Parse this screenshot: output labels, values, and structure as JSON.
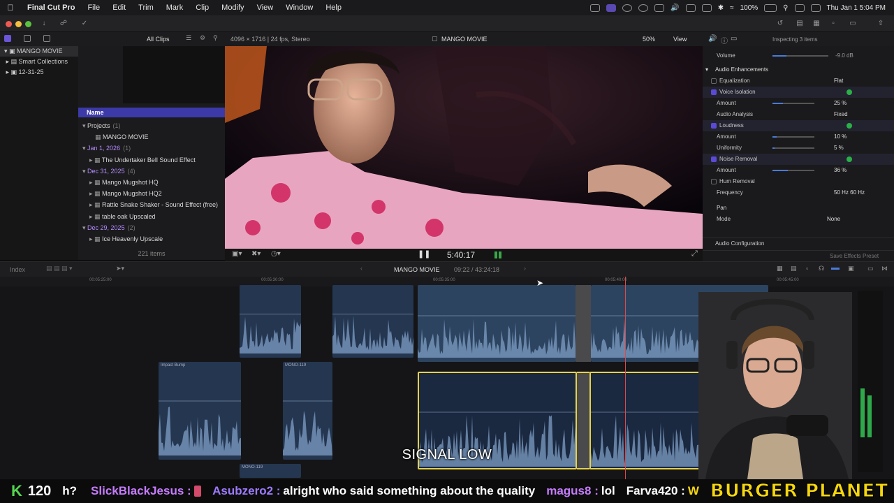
{
  "menubar": {
    "app_name": "Final Cut Pro",
    "items": [
      "File",
      "Edit",
      "Trim",
      "Mark",
      "Clip",
      "Modify",
      "View",
      "Window",
      "Help"
    ],
    "battery": "100%",
    "datetime": "Thu Jan 1 5:04 PM"
  },
  "library": {
    "items": [
      {
        "label": "MANGO MOVIE",
        "icon": "library-icon"
      },
      {
        "label": "Smart Collections",
        "icon": "folder-icon"
      },
      {
        "label": "12-31-25",
        "icon": "event-icon"
      }
    ]
  },
  "browser": {
    "filter_label": "All Clips",
    "column_name": "Name",
    "count_text": "221 items",
    "rows": [
      {
        "label": "Projects",
        "count": "(1)",
        "kind": "group"
      },
      {
        "label": "MANGO MOVIE",
        "count": "",
        "kind": "project"
      },
      {
        "label": "Jan 1, 2026",
        "count": "(1)",
        "kind": "date"
      },
      {
        "label": "The Undertaker Bell  Sound Effect",
        "count": "",
        "kind": "clip"
      },
      {
        "label": "Dec 31, 2025",
        "count": "(4)",
        "kind": "date"
      },
      {
        "label": "Mango Mugshot HQ",
        "count": "",
        "kind": "clip"
      },
      {
        "label": "Mango Mugshot HQ2",
        "count": "",
        "kind": "clip"
      },
      {
        "label": "Rattle Snake Shaker - Sound Effect (free)",
        "count": "",
        "kind": "clip"
      },
      {
        "label": "table oak Upscaled",
        "count": "",
        "kind": "clip"
      },
      {
        "label": "Dec 29, 2025",
        "count": "(2)",
        "kind": "date"
      },
      {
        "label": "Ice Heavenly Upscale",
        "count": "",
        "kind": "clip"
      }
    ]
  },
  "viewer": {
    "format": "4096 × 1716 | 24 fps, Stereo",
    "title": "MANGO MOVIE",
    "zoom": "50%",
    "view_label": "View",
    "timecode": "5:40:17"
  },
  "inspector": {
    "title": "Inspecting 3 items",
    "volume_label": "Volume",
    "volume_value": "-9.0 dB",
    "section": "Audio Enhancements",
    "rows": [
      {
        "label": "Equalization",
        "value": "Flat",
        "checked": false,
        "slider": null
      },
      {
        "label": "Voice Isolation",
        "value": "",
        "checked": true,
        "slider": null
      },
      {
        "label": "Amount",
        "value": "25 %",
        "checked": null,
        "slider": 0.25
      },
      {
        "label": "Audio Analysis",
        "value": "Fixed",
        "checked": null,
        "slider": null
      },
      {
        "label": "Loudness",
        "value": "",
        "checked": true,
        "slider": null
      },
      {
        "label": "Amount",
        "value": "10 %",
        "checked": null,
        "slider": 0.1
      },
      {
        "label": "Uniformity",
        "value": "5 %",
        "checked": null,
        "slider": 0.05
      },
      {
        "label": "Noise Removal",
        "value": "",
        "checked": true,
        "slider": null
      },
      {
        "label": "Amount",
        "value": "36 %",
        "checked": null,
        "slider": 0.36
      },
      {
        "label": "Hum Removal",
        "value": "",
        "checked": false,
        "slider": null
      },
      {
        "label": "Frequency",
        "value": "50 Hz   60 Hz",
        "checked": null,
        "slider": null
      }
    ],
    "pan_label": "Pan",
    "mode_label": "Mode",
    "mode_value": "None",
    "audio_config": "Audio Configuration",
    "save_preset": "Save Effects Preset"
  },
  "timeline": {
    "index_label": "Index",
    "project_name": "MANGO MOVIE",
    "project_timecode": "09:22 / 43:24:18",
    "ruler": [
      "00:05:25:00",
      "00:05:30:00",
      "00:05:35:00",
      "00:05:40:00",
      "00:05:45:00"
    ],
    "clip_labels": [
      "Impact Bump",
      "MONO-119",
      "MONO-119"
    ]
  },
  "caption": "SIGNAL LOW",
  "chat": {
    "k_count": "120",
    "messages": [
      {
        "user": "h?",
        "user_color": "#ffffff",
        "text": ""
      },
      {
        "user": "SlickBlackJesus :",
        "user_color": "#c67cff",
        "text": ""
      },
      {
        "user": "Asubzero2 :",
        "user_color": "#9d7bff",
        "text": "alright who said something about the quality"
      },
      {
        "user": "magus8 :",
        "user_color": "#c67cff",
        "text": "lol"
      },
      {
        "user": "Farva420 :",
        "user_color": "#ffffff",
        "text": "W"
      }
    ],
    "brand": "BURGER PLANET"
  }
}
